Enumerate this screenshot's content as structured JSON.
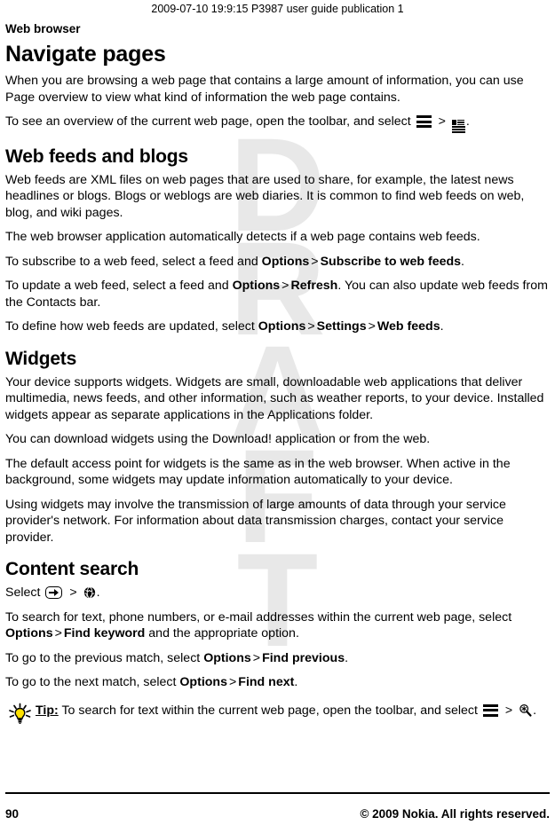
{
  "header": {
    "stamp": "2009-07-10 19:9:15 P3987 user guide publication 1"
  },
  "breadcrumb": {
    "label": "Web browser"
  },
  "sections": [
    {
      "heading": "Navigate pages",
      "paragraphs": [
        "When you are browsing a web page that contains a large amount of information, you can use Page overview to view what kind of information the web page contains.",
        "To see an overview of the current web page, open the toolbar, and select"
      ]
    },
    {
      "heading": "Web feeds and blogs",
      "paragraphs": [
        "Web feeds are XML files on web pages that are used to share, for example, the latest news headlines or blogs. Blogs or weblogs are web diaries. It is common to find web feeds on web, blog, and wiki pages.",
        "The web browser application automatically detects if a web page contains web feeds."
      ]
    },
    {
      "heading": "Widgets",
      "paragraphs": [
        "Your device supports widgets. Widgets are small, downloadable web applications that deliver multimedia, news feeds, and other information, such as weather reports, to your device. Installed widgets appear as separate applications in the Applications folder.",
        "You can download widgets using the Download! application or from the web.",
        "The default access point for widgets is the same as in the web browser. When active in the background, some widgets may update information automatically to your device.",
        "Using widgets may involve the transmission of large amounts of data through your service provider's network. For information about data transmission charges, contact your service provider."
      ]
    },
    {
      "heading": "Content search"
    }
  ],
  "instructions": {
    "subscribe_pre": "To subscribe to a web feed, select a feed and",
    "subscribe_menu1": "Options",
    "subscribe_sep": ">",
    "subscribe_menu2": "Subscribe to web feeds",
    "subscribe_post": ".",
    "update_pre": "To update a web feed, select a feed and",
    "update_menu1": "Options",
    "update_sep": ">",
    "update_menu2": "Refresh",
    "update_post": ". You can also update web feeds from the Contacts bar.",
    "define_pre": "To define how web feeds are updated, select",
    "define_menu1": "Options",
    "define_sep1": ">",
    "define_menu2": "Settings",
    "define_sep2": ">",
    "define_menu3": "Web feeds",
    "define_post": ".",
    "select_pre": "Select",
    "select_sep": ">",
    "select_post": ".",
    "search_pre": "To search for text, phone numbers, or e-mail addresses within the current web page, select",
    "search_menu1": "Options",
    "search_sep": ">",
    "search_menu2": "Find keyword",
    "search_post": "and the appropriate option.",
    "prev_pre": "To go to the previous match, select",
    "prev_menu1": "Options",
    "prev_sep": ">",
    "prev_menu2": "Find previous",
    "prev_post": ".",
    "next_pre": "To go to the next match, select",
    "next_menu1": "Options",
    "next_sep": ">",
    "next_menu2": "Find next",
    "next_post": "."
  },
  "tip": {
    "label": "Tip:",
    "text": "To search for text within the current web page, open the toolbar, and select",
    "sep": ">",
    "post": "."
  },
  "icons": {
    "toolbar": "menu-hamburger-icon",
    "page_overview": "page-overview-icon",
    "menu_key": "menu-key-icon",
    "web": "globe-icon",
    "find": "find-magnifier-icon",
    "tip_bulb": "lightbulb-icon"
  },
  "watermark": {
    "letters": [
      "D",
      "R",
      "A",
      "F",
      "T"
    ]
  },
  "footer": {
    "page_number": "90",
    "copyright": "© 2009 Nokia. All rights reserved."
  },
  "colors": {
    "text": "#000000",
    "watermark": "#e8e8e8",
    "bulb": "#ffe100",
    "background": "#ffffff"
  }
}
